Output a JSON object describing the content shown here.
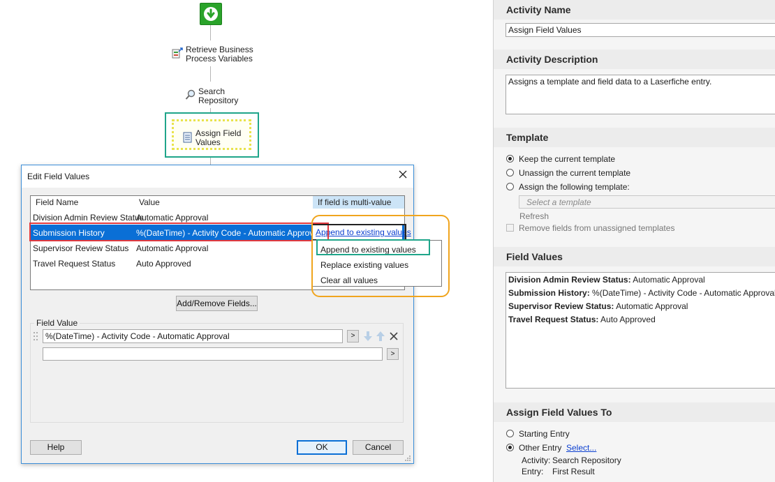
{
  "workflow": {
    "steps": [
      {
        "label_line1": "Retrieve Business",
        "label_line2": "Process Variables"
      },
      {
        "label_line1": "Search",
        "label_line2": "Repository"
      },
      {
        "label_line1": "Assign Field",
        "label_line2": "Values"
      }
    ]
  },
  "dialog": {
    "title": "Edit Field Values",
    "columns": {
      "field_name": "Field Name",
      "value": "Value",
      "multi": "If field is multi-value"
    },
    "rows": [
      {
        "field": "Division Admin Review Status",
        "value": "Automatic Approval",
        "multi": ""
      },
      {
        "field": "Submission History",
        "value": "%(DateTime) - Activity Code - Automatic Approval",
        "multi": "Append to existing values"
      },
      {
        "field": "Supervisor Review Status",
        "value": "Automatic Approval",
        "multi": ""
      },
      {
        "field": "Travel Request Status",
        "value": "Auto Approved",
        "multi": ""
      }
    ],
    "dropdown_options": [
      "Append to existing values",
      "Replace existing values",
      "Clear all values"
    ],
    "add_remove_label": "Add/Remove Fields...",
    "field_value_label": "Field Value",
    "field_value_1": "%(DateTime) - Activity Code - Automatic Approval",
    "field_value_2": "",
    "token_button": ">",
    "help_label": "Help",
    "ok_label": "OK",
    "cancel_label": "Cancel"
  },
  "panel": {
    "activity_name_head": "Activity Name",
    "activity_name": "Assign Field Values",
    "activity_desc_head": "Activity Description",
    "activity_desc": "Assigns a template and field data to a Laserfiche entry.",
    "template_head": "Template",
    "template_options": [
      "Keep the current template",
      "Unassign the current template",
      "Assign the following template:"
    ],
    "template_placeholder": "Select a template",
    "refresh_label": "Refresh",
    "remove_fields_label": "Remove fields from unassigned templates",
    "field_values_head": "Field Values",
    "field_values": [
      {
        "name": "Division Admin Review Status:",
        "value": "Automatic Approval"
      },
      {
        "name": "Submission History:",
        "value": "%(DateTime) - Activity Code - Automatic Approval"
      },
      {
        "name": "Supervisor Review Status:",
        "value": "Automatic Approval"
      },
      {
        "name": "Travel Request Status:",
        "value": "Auto Approved"
      }
    ],
    "assign_to_head": "Assign Field Values To",
    "assign_options": [
      "Starting Entry",
      "Other Entry"
    ],
    "select_link": "Select...",
    "activity_label": "Activity:",
    "activity_value": "Search Repository",
    "entry_label": "Entry:",
    "entry_value": "First Result"
  },
  "colors": {
    "highlight_red": "#e0393e",
    "highlight_teal": "#1fa58a",
    "highlight_orange": "#f0a51e",
    "selection_blue": "#0a6fd6",
    "link_blue": "#0b3fd0"
  }
}
